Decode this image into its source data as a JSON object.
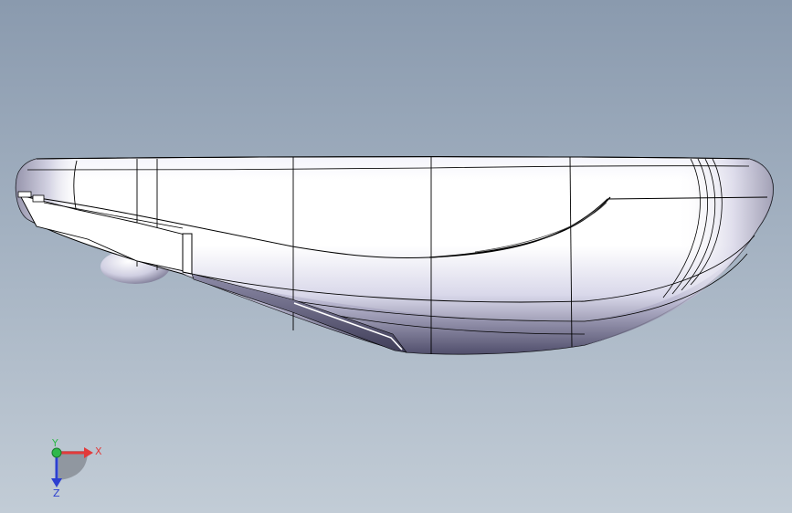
{
  "viewport": {
    "background_top": "#8a9aae",
    "background_bottom": "#c2ccd6"
  },
  "model": {
    "body_color": "#ffffff",
    "shade_color": "#6c6a86",
    "edge_color": "#000000"
  },
  "triad": {
    "x_label": "X",
    "y_label": "Y",
    "z_label": "Z",
    "x_color": "#e23a3a",
    "y_color": "#2fb84a",
    "z_color": "#2c3fd0"
  }
}
